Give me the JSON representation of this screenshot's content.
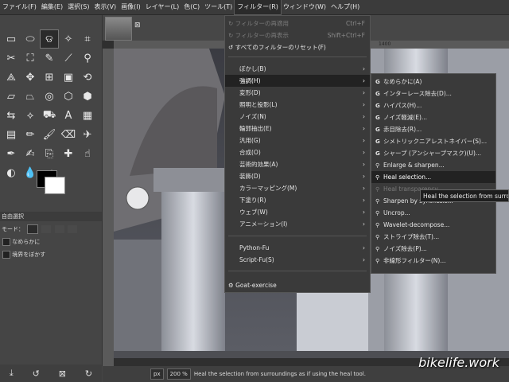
{
  "menubar": {
    "items": [
      "ファイル(F)",
      "編集(E)",
      "選択(S)",
      "表示(V)",
      "画像(I)",
      "レイヤー(L)",
      "色(C)",
      "ツール(T)",
      "フィルター(R)",
      "ウィンドウ(W)",
      "ヘルプ(H)"
    ]
  },
  "filters_menu": {
    "reapply": {
      "label": "フィルターの再適用",
      "shortcut": "Ctrl+F"
    },
    "reshow": {
      "label": "フィルターの再表示",
      "shortcut": "Shift+Ctrl+F"
    },
    "reset_all": "すべてのフィルターのリセット(F)",
    "categories": [
      "ぼかし(B)",
      "強調(H)",
      "変形(D)",
      "照明と投影(L)",
      "ノイズ(N)",
      "輪郭抽出(E)",
      "汎用(G)",
      "合成(O)",
      "芸術的効果(A)",
      "装飾(D)",
      "カラーマッピング(M)",
      "下塗り(R)",
      "ウェブ(W)",
      "アニメーション(I)"
    ],
    "scripts": [
      "Python-Fu",
      "Script-Fu(S)"
    ],
    "extra": "Goat-exercise"
  },
  "enhance_menu": {
    "items": [
      "なめらかに(A)",
      "インターレース除去(D)...",
      "ハイパス(H)...",
      "ノイズ軽減(E)...",
      "赤目除去(R)...",
      "シメトリックニアレストネイバー(S)...",
      "シャープ (アンシャープマスク)(U)...",
      "Enlarge & sharpen...",
      "Heal selection...",
      "Heal transparency...",
      "Sharpen by synthesis...",
      "Uncrop...",
      "Wavelet-decompose...",
      "ストライプ除去(T)...",
      "ノイズ除去(P)...",
      "非線形フィルター(N)..."
    ]
  },
  "tooltip": "Heal the selection from surroundings as if using the heal tool.",
  "tool_options": {
    "title": "自由選択",
    "mode_label": "モード：",
    "antialias": "なめらかに",
    "feather": "境界をぼかす"
  },
  "ruler": {
    "mark_1400": "1400"
  },
  "statusbar": {
    "unit": "px",
    "zoom": "200 %",
    "message": "Heal the selection from surroundings as if using the heal tool."
  },
  "watermark": "bikelife.work",
  "colors": {
    "accent_fg": "#000000",
    "accent_bg": "#ffffff"
  }
}
